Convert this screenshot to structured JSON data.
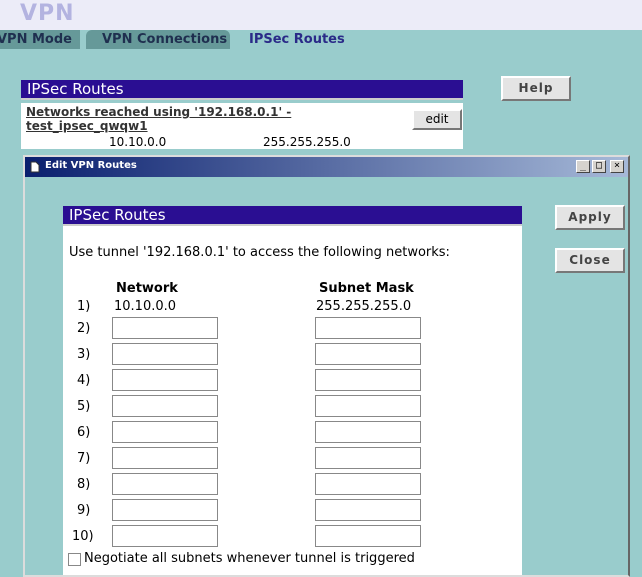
{
  "app": {
    "title": "VPN"
  },
  "tabs": [
    {
      "label": "VPN Mode"
    },
    {
      "label": "VPN Connections"
    },
    {
      "label": "IPSec Routes"
    }
  ],
  "routes_panel": {
    "title": "IPSec Routes",
    "network_header": "Networks reached using '192.168.0.1' - test_ipsec_qwqw1",
    "network": "10.10.0.0",
    "mask": "255.255.255.0",
    "edit_label": "edit"
  },
  "help_label": "Help",
  "dialog": {
    "title": "Edit VPN Routes",
    "controls": {
      "minimize": "_",
      "maximize": "□",
      "close": "×"
    },
    "section_title": "IPSec Routes",
    "instruction": "Use tunnel '192.168.0.1' to access the following networks:",
    "col_network": "Network",
    "col_mask": "Subnet Mask",
    "row1": {
      "num": "1)",
      "network": "10.10.0.0",
      "mask": "255.255.255.0"
    },
    "rows": [
      {
        "num": "2)",
        "network": "",
        "mask": ""
      },
      {
        "num": "3)",
        "network": "",
        "mask": ""
      },
      {
        "num": "4)",
        "network": "",
        "mask": ""
      },
      {
        "num": "5)",
        "network": "",
        "mask": ""
      },
      {
        "num": "6)",
        "network": "",
        "mask": ""
      },
      {
        "num": "7)",
        "network": "",
        "mask": ""
      },
      {
        "num": "8)",
        "network": "",
        "mask": ""
      },
      {
        "num": "9)",
        "network": "",
        "mask": ""
      },
      {
        "num": "10)",
        "network": "",
        "mask": ""
      }
    ],
    "negotiate_label": "Negotiate all subnets whenever tunnel is triggered",
    "negotiate_checked": false,
    "apply_label": "Apply",
    "close_label": "Close"
  }
}
